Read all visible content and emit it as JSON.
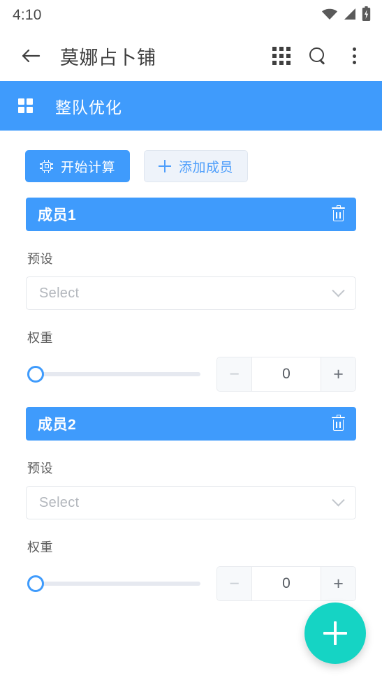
{
  "status_bar": {
    "time": "4:10",
    "icons": [
      "wifi-icon",
      "cellular-signal-icon",
      "battery-charging-icon"
    ]
  },
  "toolbar": {
    "back_icon": "arrow-left-icon",
    "title": "莫娜占卜铺",
    "apps_icon": "apps-grid-icon",
    "search_icon": "search-icon",
    "overflow_icon": "more-vertical-icon"
  },
  "section": {
    "icon": "grid-2x2-icon",
    "title": "整队优化",
    "background": "#3f9bfc"
  },
  "actions": {
    "calculate": {
      "label": "开始计算",
      "icon": "cpu-chip-icon"
    },
    "add_member": {
      "label": "添加成员",
      "icon": "plus-icon"
    }
  },
  "members": [
    {
      "name": "成员1",
      "delete_icon": "trash-icon",
      "preset_label": "预设",
      "preset_placeholder": "Select",
      "weight_label": "权重",
      "weight_value": "0",
      "minus_label": "−",
      "plus_label": "+"
    },
    {
      "name": "成员2",
      "delete_icon": "trash-icon",
      "preset_label": "预设",
      "preset_placeholder": "Select",
      "weight_label": "权重",
      "weight_value": "0",
      "minus_label": "−",
      "plus_label": "+"
    }
  ],
  "fab": {
    "icon": "plus-icon",
    "color": "#15d4c4"
  },
  "colors": {
    "primary_blue": "#3f9bfc",
    "accent_teal": "#15d4c4",
    "ghost_button_bg": "#eef3fa",
    "track_gray": "#e6e9f0"
  }
}
